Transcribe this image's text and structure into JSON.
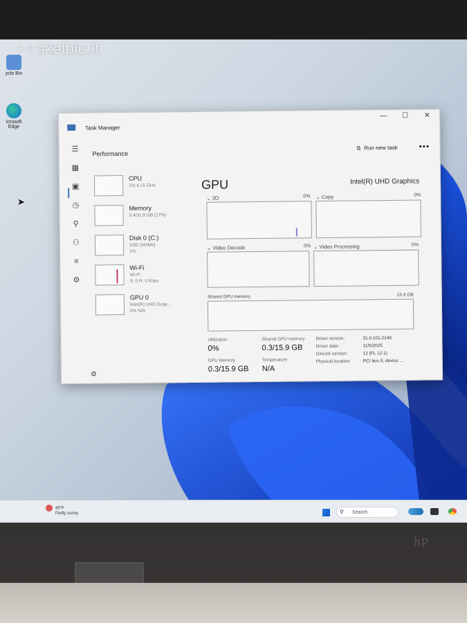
{
  "watermark": "skelbiu.lt",
  "desktop": {
    "icons": [
      {
        "label": "ycle Bin"
      },
      {
        "label": "icrosoft Edge"
      }
    ]
  },
  "window": {
    "title": "Task Manager",
    "section": "Performance",
    "run_new_task": "Run new task",
    "more": "•••",
    "controls": {
      "minimize": "—",
      "maximize": "☐",
      "close": "✕"
    }
  },
  "devices": [
    {
      "name": "CPU",
      "sub": "1% 4.15 GHz",
      "sub2": ""
    },
    {
      "name": "Memory",
      "sub": "5.4/31.8 GB (17%)",
      "sub2": ""
    },
    {
      "name": "Disk 0 (C:)",
      "sub": "SSD (NVMe)",
      "sub2": "1%"
    },
    {
      "name": "Wi-Fi",
      "sub": "Wi-Fi",
      "sub2": "S: 0 R: 0 Kbps"
    },
    {
      "name": "GPU 0",
      "sub": "Intel(R) UHD Grap...",
      "sub2": "0% N/A"
    }
  ],
  "gpu": {
    "title": "GPU",
    "model": "Intel(R) UHD Graphics",
    "engines": [
      {
        "label": "3D",
        "pct": "0%"
      },
      {
        "label": "Copy",
        "pct": "0%"
      },
      {
        "label": "Video Decode",
        "pct": "0%"
      },
      {
        "label": "Video Processing",
        "pct": "0%"
      }
    ],
    "shared_label": "Shared GPU memory",
    "shared_max": "15.9 GB",
    "stats": [
      {
        "label": "Utilization",
        "value": "0%"
      },
      {
        "label": "Shared GPU memory",
        "value": "0.3/15.9 GB"
      },
      {
        "label": "GPU Memory",
        "value": "0.3/15.9 GB"
      },
      {
        "label": "Temperature",
        "value": "N/A"
      }
    ],
    "details": [
      {
        "label": "Driver version:",
        "value": "31.0.101.2140"
      },
      {
        "label": "Driver date:",
        "value": "11/5/2025"
      },
      {
        "label": "DirectX version:",
        "value": "12 (FL 12.1)"
      },
      {
        "label": "Physical location:",
        "value": "PCI bus 0, device ..."
      }
    ]
  },
  "taskbar": {
    "weather_temp": "45°F",
    "weather_desc": "Partly sunny",
    "search_placeholder": "Search"
  },
  "brand": "hp"
}
